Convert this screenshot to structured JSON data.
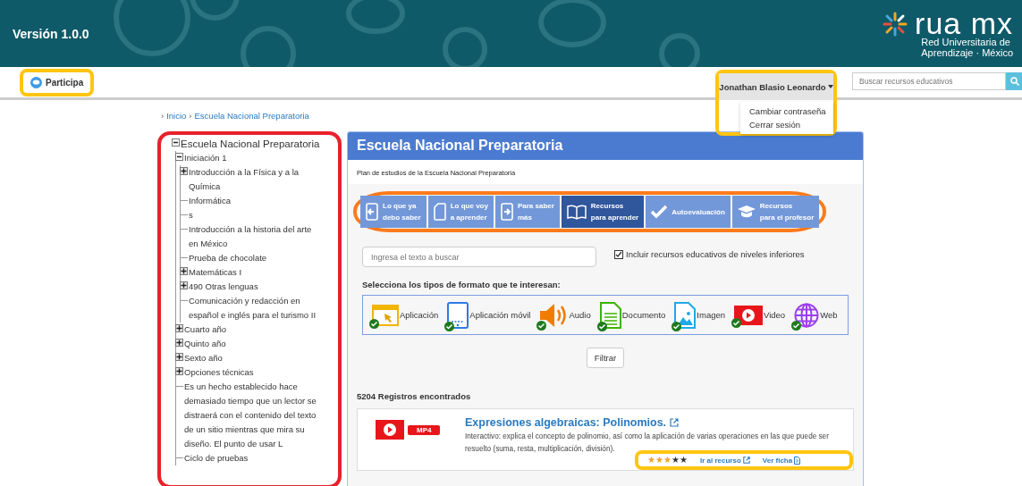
{
  "header": {
    "version": "Versión 1.0.0",
    "logo_text": "rua mx",
    "logo_subtitle": "Red Universitaria de\nAprendizaje · México"
  },
  "nav": {
    "participa": "Participa",
    "user": "Jonathan Blasio Leonardo",
    "user_menu_open": true,
    "user_menu": [
      "Cambiar contraseña",
      "Cerrar sesión"
    ],
    "search": {
      "placeholder": "Buscar recursos educativos"
    }
  },
  "breadcrumb": {
    "separator": "›",
    "items": [
      "Inicio",
      "Escuela Nacional Preparatoria"
    ]
  },
  "tree": {
    "label": "Escuela Nacional Preparatoria",
    "expanded": true,
    "children": [
      {
        "label": "Iniciación 1",
        "expanded": true,
        "children": [
          {
            "label": "Introducción a la Física y a la Química",
            "expanded": false
          },
          {
            "label": "Informática"
          },
          {
            "label": "s"
          },
          {
            "label": "Introducción a la historia del arte en México"
          },
          {
            "label": "Prueba de chocolate"
          },
          {
            "label": "Matemáticas I",
            "expanded": false
          },
          {
            "label": "490 Otras lenguas",
            "expanded": false
          },
          {
            "label": "Comunicación y redacción en español e inglés para el turismo II"
          }
        ]
      },
      {
        "label": "Cuarto año",
        "expanded": false
      },
      {
        "label": "Quinto año",
        "expanded": false
      },
      {
        "label": "Sexto año",
        "expanded": false
      },
      {
        "label": "Opciones técnicas",
        "expanded": false
      },
      {
        "label": "Es un hecho establecido hace demasiado tiempo que un lector se distraerá con el contenido del texto de un sitio mientras que mira su diseño. El punto de usar L"
      },
      {
        "label": "Ciclo de pruebas"
      }
    ]
  },
  "panel": {
    "title": "Escuela Nacional Preparatoria",
    "subtitle": "Plan de estudios de la Escuela Nacional Preparatoria",
    "tabs": [
      {
        "label": "Lo que ya\ndebo saber",
        "kind": "back",
        "selected": false
      },
      {
        "label": "Lo que voy\na aprender",
        "kind": "page",
        "selected": false
      },
      {
        "label": "Para saber\nmás",
        "kind": "forward",
        "selected": false
      },
      {
        "label": "Recursos\npara aprender",
        "kind": "book",
        "selected": true
      },
      {
        "label": "Autoevaluación",
        "kind": "check",
        "selected": false
      },
      {
        "label": "Recursos\npara el profesor",
        "kind": "cap",
        "selected": false
      }
    ],
    "search_placeholder": "Ingresa el texto a buscar",
    "include_lower": {
      "label": "Incluir recursos educativos de niveles inferiores",
      "checked": true
    },
    "formats_title": "Selecciona los tipos de formato que te interesan:",
    "formats": [
      {
        "label": "Aplicación",
        "kind": "app",
        "checked": true
      },
      {
        "label": "Aplicación móvil",
        "kind": "mobile",
        "checked": true
      },
      {
        "label": "Audio",
        "kind": "audio",
        "checked": true
      },
      {
        "label": "Documento",
        "kind": "document",
        "checked": true
      },
      {
        "label": "Imagen",
        "kind": "image",
        "checked": true
      },
      {
        "label": "Video",
        "kind": "video",
        "checked": true
      },
      {
        "label": "Web",
        "kind": "web",
        "checked": true
      }
    ],
    "filter_button": "Filtrar",
    "results_count": "5204 Registros encontrados",
    "results": [
      {
        "format": "MP4",
        "kind": "video",
        "title": "Expresiones algebraicas: Polinomios.",
        "description": "Interactivo: explica el concepto de polinomio, así como la aplicación de varias operaciones en las que puede ser resuelto (suma, resta, multiplicación, división).",
        "stars": 3,
        "go_link": "Ir al recurso",
        "sheet_link": "Ver ficha"
      }
    ]
  }
}
